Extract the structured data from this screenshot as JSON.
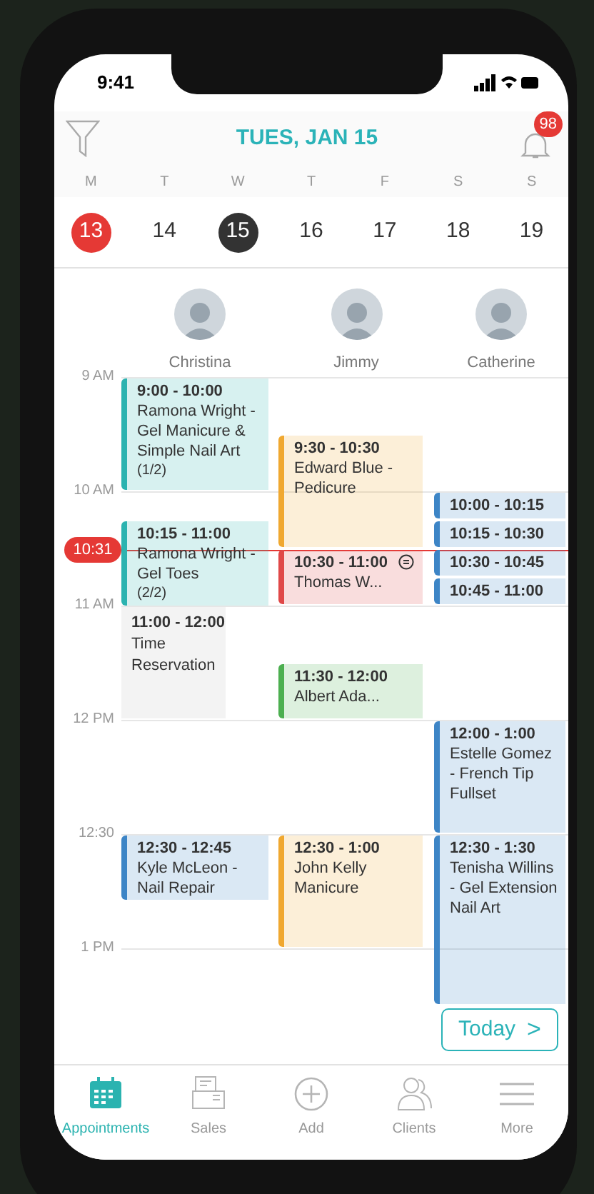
{
  "status_bar": {
    "time": "9:41"
  },
  "header": {
    "title": "TUES, JAN 15",
    "notification_count": "98"
  },
  "week": [
    {
      "weekday": "M",
      "date": "13",
      "today": true,
      "selected": false
    },
    {
      "weekday": "T",
      "date": "14",
      "today": false,
      "selected": false
    },
    {
      "weekday": "W",
      "date": "15",
      "today": false,
      "selected": true
    },
    {
      "weekday": "T",
      "date": "16",
      "today": false,
      "selected": false
    },
    {
      "weekday": "F",
      "date": "17",
      "today": false,
      "selected": false
    },
    {
      "weekday": "S",
      "date": "18",
      "today": false,
      "selected": false
    },
    {
      "weekday": "S",
      "date": "19",
      "today": false,
      "selected": false
    }
  ],
  "time_labels": [
    "9 AM",
    "10 AM",
    "11 AM",
    "12 PM",
    "12:30",
    "1 PM"
  ],
  "current_time": "10:31",
  "staff": [
    {
      "name": "Christina",
      "appointments": [
        {
          "kind": "appointment",
          "time": "9:00 - 10:00",
          "text": "Ramona Wright - Gel Manicure & Simple Nail Art",
          "part": "(1/2)",
          "color": "#2bb3b0",
          "has_note": false
        },
        {
          "kind": "appointment",
          "time": "10:15 - 11:00",
          "text": "Ramona Wright - Gel Toes",
          "part": "(2/2)",
          "color": "#2bb3b0",
          "has_note": false
        },
        {
          "kind": "reservation",
          "time": "11:00 - 12:00",
          "text": "Time Reservation"
        },
        {
          "kind": "appointment",
          "time": "12:30 - 12:45",
          "text": "Kyle McLeon - Nail Repair",
          "color": "#3d85c6",
          "has_note": false
        }
      ]
    },
    {
      "name": "Jimmy",
      "appointments": [
        {
          "kind": "appointment",
          "time": "9:30 - 10:30",
          "text": "Edward Blue - Pedicure",
          "color": "#f0a830",
          "has_note": false
        },
        {
          "kind": "appointment",
          "time": "10:30 - 11:00",
          "text": "Thomas W...",
          "color": "#e04848",
          "has_note": true
        },
        {
          "kind": "appointment",
          "time": "11:30 - 12:00",
          "text": "Albert Ada...",
          "color": "#4caf50",
          "has_note": false
        },
        {
          "kind": "appointment",
          "time": "12:30 - 1:00",
          "text": "John Kelly Manicure",
          "color": "#f0a830",
          "has_note": false
        }
      ]
    },
    {
      "name": "Catherine",
      "appointments": [
        {
          "kind": "appointment",
          "time": "10:00 - 10:15",
          "color": "#3d85c6",
          "has_note": false
        },
        {
          "kind": "appointment",
          "time": "10:15 - 10:30",
          "color": "#3d85c6",
          "has_note": false
        },
        {
          "kind": "appointment",
          "time": "10:30 - 10:45",
          "color": "#3d85c6",
          "has_note": false
        },
        {
          "kind": "appointment",
          "time": "10:45 - 11:00",
          "color": "#3d85c6",
          "has_note": false
        },
        {
          "kind": "appointment",
          "time": "12:00 - 1:00",
          "text": "Estelle Gomez - French Tip Fullset",
          "color": "#3d85c6",
          "has_note": false
        },
        {
          "kind": "appointment",
          "time": "12:30 - 1:30",
          "text": "Tenisha Willins - Gel Extension Nail Art",
          "color": "#3d85c6",
          "has_note": false
        }
      ]
    }
  ],
  "today_button": {
    "label": "Today",
    "icon": ">"
  },
  "tab_bar": [
    {
      "kind": "calendar",
      "label": "Appointments",
      "selected": true
    },
    {
      "kind": "register",
      "label": "Sales",
      "selected": false
    },
    {
      "kind": "add",
      "label": "Add",
      "selected": false
    },
    {
      "kind": "clients",
      "label": "Clients",
      "selected": false
    },
    {
      "kind": "more",
      "label": "More",
      "selected": false
    }
  ]
}
